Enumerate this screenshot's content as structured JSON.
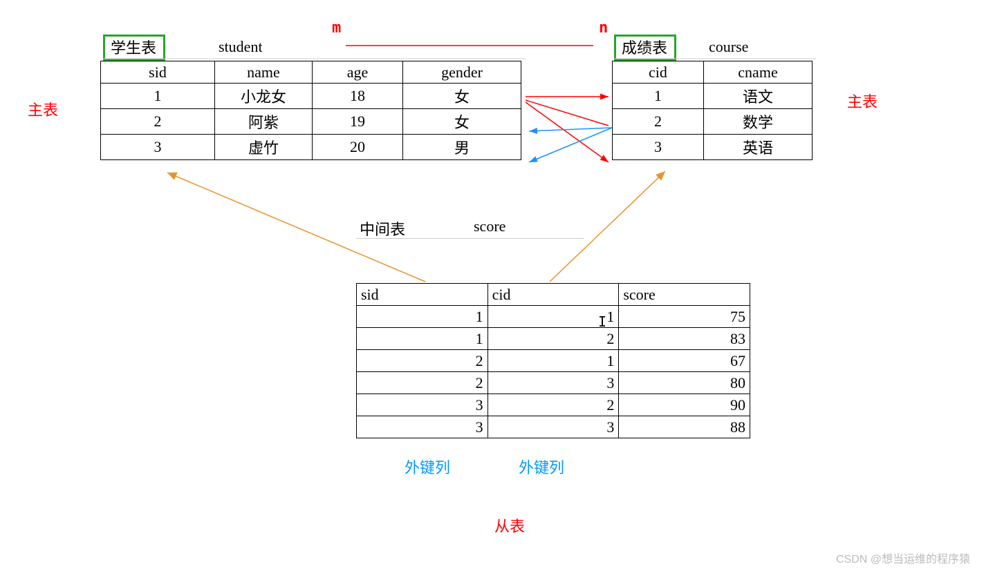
{
  "labels": {
    "main_table_left": "主表",
    "main_table_right": "主表",
    "sub_table": "从表",
    "fk_col_1": "外键列",
    "fk_col_2": "外键列",
    "m_label": "m",
    "n_label": "n",
    "watermark": "CSDN @想当运维的程序猿"
  },
  "student": {
    "title_cn": "学生表",
    "title_en": "student",
    "headers": [
      "sid",
      "name",
      "age",
      "gender"
    ],
    "rows": [
      [
        "1",
        "小龙女",
        "18",
        "女"
      ],
      [
        "2",
        "阿紫",
        "19",
        "女"
      ],
      [
        "3",
        "虚竹",
        "20",
        "男"
      ]
    ]
  },
  "course": {
    "title_cn": "成绩表",
    "title_en": "course",
    "headers": [
      "cid",
      "cname"
    ],
    "rows": [
      [
        "1",
        "语文"
      ],
      [
        "2",
        "数学"
      ],
      [
        "3",
        "英语"
      ]
    ]
  },
  "score": {
    "title_cn": "中间表",
    "title_en": "score",
    "headers": [
      "sid",
      "cid",
      "score"
    ],
    "rows": [
      [
        "1",
        "1",
        "75"
      ],
      [
        "1",
        "2",
        "83"
      ],
      [
        "2",
        "1",
        "67"
      ],
      [
        "2",
        "3",
        "80"
      ],
      [
        "3",
        "2",
        "90"
      ],
      [
        "3",
        "3",
        "88"
      ]
    ]
  },
  "arrows": {
    "red_mn_line": true,
    "red_cross_1": "student-row1 -> course-row1",
    "red_cross_2": "student-row1 -> course-row3",
    "blue_cross_1": "course-row2 -> student-row2",
    "blue_cross_2": "course-row2 -> student-row3",
    "orange_1": "score-sid -> student-row3-sid",
    "orange_2": "score-cid -> course-row3-cid"
  }
}
